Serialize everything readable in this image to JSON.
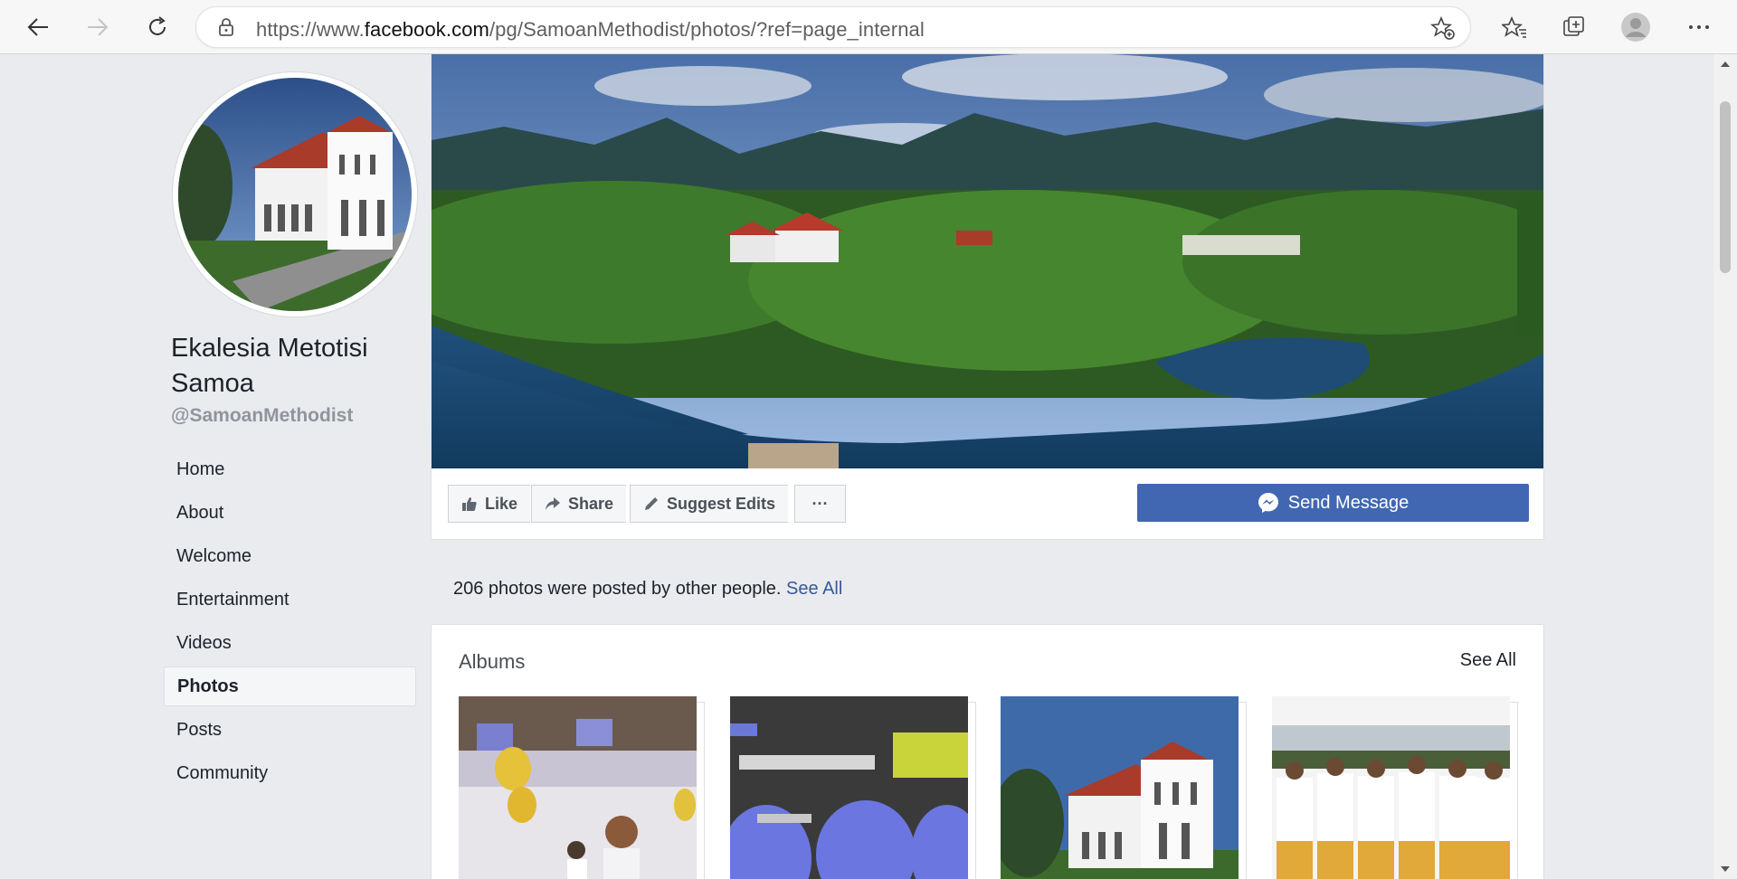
{
  "browser": {
    "url_prefix": "https://www.",
    "url_host": "facebook.com",
    "url_path": "/pg/SamoanMethodist/photos/?ref=page_internal",
    "icons": [
      "back-icon",
      "forward-icon",
      "refresh-icon",
      "lock-icon",
      "add-favorite-icon",
      "favorites-icon",
      "collections-icon",
      "profile-icon",
      "more-icon"
    ]
  },
  "page": {
    "name": "Ekalesia Metotisi Samoa",
    "handle": "@SamoanMethodist"
  },
  "sidebar": {
    "items": [
      {
        "label": "Home"
      },
      {
        "label": "About"
      },
      {
        "label": "Welcome"
      },
      {
        "label": "Entertainment"
      },
      {
        "label": "Videos"
      },
      {
        "label": "Photos",
        "active": true
      },
      {
        "label": "Posts"
      },
      {
        "label": "Community"
      }
    ]
  },
  "actions": {
    "like": "Like",
    "share": "Share",
    "suggest": "Suggest Edits",
    "more": "···",
    "send_message": "Send Message"
  },
  "posted": {
    "text": "206 photos were posted by other people.",
    "link": "See All"
  },
  "albums": {
    "title": "Albums",
    "see_all": "See All"
  },
  "colors": {
    "brand": "#4267b2",
    "link": "#385898",
    "background": "#e9ebee"
  }
}
